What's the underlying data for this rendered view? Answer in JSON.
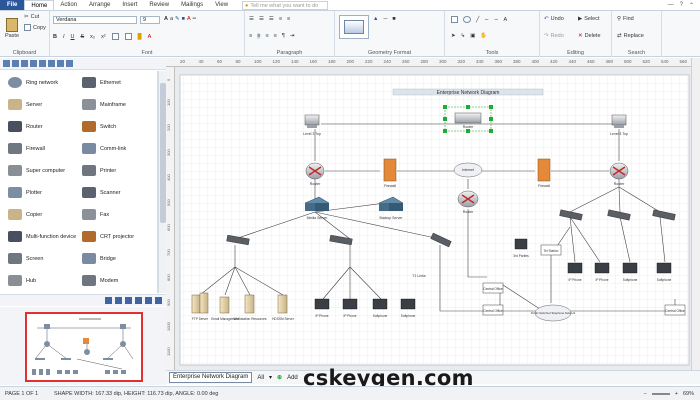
{
  "ribbon_tabs": [
    "File",
    "Home",
    "Action",
    "Arrange",
    "Insert",
    "Review",
    "Mailings",
    "View"
  ],
  "tell_me": "Tell me what you want to do",
  "clipboard": {
    "paste": "Paste",
    "cut": "Cut",
    "copy": "Copy",
    "label": "Clipboard"
  },
  "font": {
    "family": "Verdana",
    "size": "9",
    "label": "Font"
  },
  "paragraph": {
    "label": "Paragraph"
  },
  "geometry": {
    "label": "Geometry Format"
  },
  "tools": {
    "label": "Tools"
  },
  "editing": {
    "undo": "Undo",
    "redo": "Redo",
    "select": "Select",
    "delete": "Delete",
    "label": "Editing"
  },
  "search": {
    "find": "Find",
    "replace": "Replace",
    "label": "Search"
  },
  "palette": {
    "items": [
      {
        "label": "Ring network",
        "icon": "ring-network-icon"
      },
      {
        "label": "Ethernet",
        "icon": "ethernet-icon"
      },
      {
        "label": "Server",
        "icon": "server-icon"
      },
      {
        "label": "Mainframe",
        "icon": "mainframe-icon"
      },
      {
        "label": "Router",
        "icon": "router-icon"
      },
      {
        "label": "Switch",
        "icon": "switch-icon"
      },
      {
        "label": "Firewall",
        "icon": "firewall-icon"
      },
      {
        "label": "Comm-link",
        "icon": "comm-link-icon"
      },
      {
        "label": "Super computer",
        "icon": "super-computer-icon"
      },
      {
        "label": "Printer",
        "icon": "printer-icon"
      },
      {
        "label": "Plotter",
        "icon": "plotter-icon"
      },
      {
        "label": "Scanner",
        "icon": "scanner-icon"
      },
      {
        "label": "Copier",
        "icon": "copier-icon"
      },
      {
        "label": "Fax",
        "icon": "fax-icon"
      },
      {
        "label": "Multi-function device",
        "icon": "multifunction-icon"
      },
      {
        "label": "CRT projector",
        "icon": "crt-projector-icon"
      },
      {
        "label": "Screen",
        "icon": "screen-icon"
      },
      {
        "label": "Bridge",
        "icon": "bridge-icon"
      },
      {
        "label": "Hub",
        "icon": "hub-icon"
      },
      {
        "label": "Modem",
        "icon": "modem-icon"
      }
    ]
  },
  "ruler_top": [
    "20",
    "40",
    "60",
    "80",
    "100",
    "120",
    "140",
    "160",
    "180",
    "200",
    "220",
    "240",
    "260",
    "280",
    "300",
    "320",
    "340",
    "360",
    "380",
    "400",
    "420",
    "440",
    "460",
    "480",
    "500",
    "520",
    "540",
    "560"
  ],
  "ruler_left": [
    "0",
    "100",
    "200",
    "300",
    "400",
    "500",
    "600",
    "700",
    "800",
    "900",
    "1000",
    "1100"
  ],
  "diagram": {
    "title": "Enterprise Network Diagram",
    "nodes": {
      "l3_left": "Level 3 Top",
      "l3_right": "Level 3 Top",
      "center_router": "Router",
      "router_left": "Router",
      "router_right": "Router",
      "firewall_left": "Firewall",
      "firewall_right": "Firewall",
      "internet": "Internet",
      "router_mid": "Router",
      "media_server": "Media Server",
      "backup_server": "Backup Server",
      "cluster_label": "T1 Links",
      "pc_3rd": "3rd Parties",
      "ext": "Tel Station",
      "central_office": "Central Office",
      "central_office_2": "Central Office",
      "central_office_3": "Central Office",
      "pstn": "Public Switched Telephone Network",
      "servers": [
        "FTP Server",
        "Email Management",
        "Workstation Resources",
        "HDSSM Server"
      ],
      "pcs_mid": [
        "IP Phone",
        "IP Phone",
        "Softphone",
        "Softphone"
      ],
      "pcs_right": [
        "IP Phone",
        "IP Phone",
        "Softphone",
        "Softphone"
      ]
    }
  },
  "page_tab": "Enterprise Network Diagram",
  "all_label": "All",
  "add_label": "Add",
  "status": {
    "page": "PAGE 1 OF 1",
    "shape": "SHAPE WIDTH: 167.33 dip, HEIGHT: 116.73 dip, ANGLE: 0.00 deg",
    "zoom": "69%"
  },
  "watermark": "cskeygen.com",
  "colors": {
    "accent": "#2b579a",
    "selection": "#1faa3a",
    "highlight": "#e03030"
  }
}
